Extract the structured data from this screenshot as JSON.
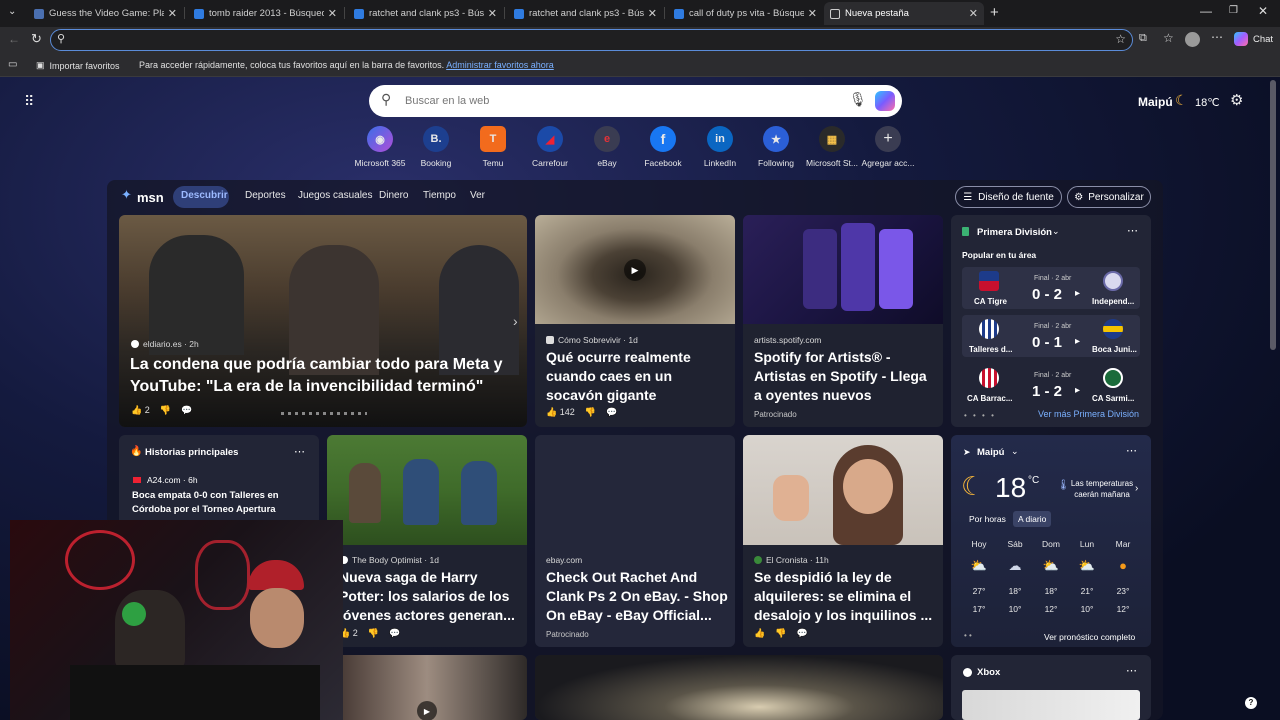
{
  "tabs": [
    {
      "title": "Guess the Video Game: Play Game"
    },
    {
      "title": "tomb raider 2013 - Búsqueda"
    },
    {
      "title": "ratchet and clank ps3 - Búsqueda"
    },
    {
      "title": "ratchet and clank ps3 - Búsqueda"
    },
    {
      "title": "call of duty ps vita - Búsqueda"
    },
    {
      "title": "Nueva pestaña"
    }
  ],
  "toolbar": {
    "chat_label": "Chat"
  },
  "favorites_bar": {
    "import_label": "Importar favoritos",
    "hint": "Para acceder rápidamente, coloca tus favoritos aquí en la barra de favoritos.",
    "manage_link": "Administrar favoritos ahora"
  },
  "header": {
    "location": "Maipú",
    "temp": "18℃"
  },
  "search": {
    "placeholder": "Buscar en la web"
  },
  "quick_links": [
    {
      "label": "Microsoft 365",
      "glyph": "◉"
    },
    {
      "label": "Booking",
      "glyph": "B."
    },
    {
      "label": "Temu",
      "glyph": "T"
    },
    {
      "label": "Carrefour",
      "glyph": "◢"
    },
    {
      "label": "eBay",
      "glyph": "e"
    },
    {
      "label": "Facebook",
      "glyph": "f"
    },
    {
      "label": "LinkedIn",
      "glyph": "in"
    },
    {
      "label": "Following",
      "glyph": "★"
    },
    {
      "label": "Microsoft St...",
      "glyph": "▦"
    },
    {
      "label": "Agregar acc...",
      "glyph": "+"
    }
  ],
  "msn": {
    "logo": "msn",
    "nav": [
      "Descubrir",
      "Deportes",
      "Juegos casuales",
      "Dinero",
      "Tiempo",
      "Ver"
    ],
    "font_button": "Diseño de fuente",
    "personalize_button": "Personalizar"
  },
  "hero": {
    "source": "eldiario.es · 2h",
    "headline": "La condena que podría cambiar todo para Meta y YouTube: \"La era de la invencibilidad terminó\"",
    "likes": "2"
  },
  "card_sinkhole": {
    "source": "Cómo Sobrevivir · 1d",
    "headline": "Qué ocurre realmente cuando caes en un socavón gigante",
    "likes": "142"
  },
  "card_spotify": {
    "source": "artists.spotify.com",
    "headline": "Spotify for Artists® - Artistas en Spotify - Llega a oyentes nuevos",
    "sponsored": "Patrocinado"
  },
  "sports": {
    "league": "Primera División",
    "subtitle": "Popular en tu área",
    "more": "Ver más Primera División",
    "matches": [
      {
        "status": "Final · 2 abr",
        "home": "CA Tigre",
        "score": "0 - 2",
        "away": "Independ..."
      },
      {
        "status": "Final · 2 abr",
        "home": "Talleres d...",
        "score": "0 - 1",
        "away": "Boca Juni..."
      },
      {
        "status": "Final · 2 abr",
        "home": "CA Barrac...",
        "score": "1 - 2",
        "away": "CA Sarmi..."
      }
    ]
  },
  "top_stories": {
    "title": "Historias principales",
    "item_source": "A24.com · 6h",
    "item_headline": "Boca empata 0-0 con Talleres en Córdoba por el Torneo Apertura"
  },
  "card_potter": {
    "source": "The Body Optimist · 1d",
    "headline": "Nueva saga de Harry Potter: los salarios de los jóvenes actores generan...",
    "likes": "2"
  },
  "card_ebay": {
    "source": "ebay.com",
    "headline": "Check Out Rachet And Clank Ps 2 On eBay. - Shop On eBay - eBay Official...",
    "sponsored": "Patrocinado"
  },
  "card_rent": {
    "source": "El Cronista · 11h",
    "headline": "Se despidió la ley de alquileres: se elimina el desalojo y los inquilinos ..."
  },
  "weather": {
    "location": "Maipú",
    "temp": "18",
    "unit": "°C",
    "note": "Las temperaturas caerán mañana",
    "tab_hourly": "Por horas",
    "tab_daily": "A diario",
    "days": [
      {
        "name": "Hoy",
        "hi": "27°",
        "lo": "17°"
      },
      {
        "name": "Sáb",
        "hi": "18°",
        "lo": "10°"
      },
      {
        "name": "Dom",
        "hi": "18°",
        "lo": "12°"
      },
      {
        "name": "Lun",
        "hi": "21°",
        "lo": "10°"
      },
      {
        "name": "Mar",
        "hi": "23°",
        "lo": "12°"
      }
    ],
    "forecast_link": "Ver pronóstico completo"
  },
  "xbox": {
    "title": "Xbox"
  },
  "colors": {
    "accent": "#5b8cd9",
    "link": "#7ab0ff",
    "card": "#1f2230",
    "active_pill": "#2f3f78"
  }
}
